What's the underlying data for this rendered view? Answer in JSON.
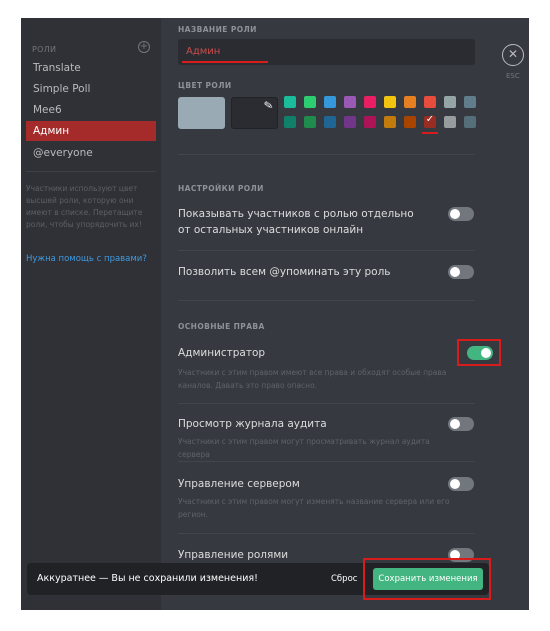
{
  "sidebar": {
    "header": "РОЛИ",
    "add_icon": "plus-circle-icon",
    "roles": [
      {
        "label": "Translate",
        "active": false
      },
      {
        "label": "Simple Poll",
        "active": false
      },
      {
        "label": "Mee6",
        "active": false
      },
      {
        "label": "Админ",
        "active": true
      },
      {
        "label": "@everyone",
        "active": false
      }
    ],
    "help_text": "Участники используют цвет высшей роли, которую они имеют в списке. Перетащите роли, чтобы упорядочить их!",
    "help_link": "Нужна помощь с правами?"
  },
  "role_name": {
    "label": "НАЗВАНИЕ РОЛИ",
    "value": "Админ"
  },
  "role_color": {
    "label": "ЦВЕТ РОЛИ",
    "picker_icon": "eyedropper-icon",
    "default_color": "#99aab5",
    "swatches_top": [
      "#1abc9c",
      "#2ecc71",
      "#3498db",
      "#9b59b6",
      "#e91e63",
      "#f1c40f",
      "#e67e22",
      "#e74c3c",
      "#95a5a6",
      "#607d8b"
    ],
    "swatches_bottom": [
      "#11806a",
      "#1f8b4c",
      "#206694",
      "#71368a",
      "#ad1457",
      "#c27c0e",
      "#a84300",
      "#992d22",
      "#979c9f",
      "#546e7a"
    ],
    "selected": "#992d22"
  },
  "role_settings": {
    "label": "НАСТРОЙКИ РОЛИ",
    "items": [
      {
        "title": "Показывать участников с ролью отдельно от остальных участников онлайн",
        "enabled": false
      },
      {
        "title": "Позволить всем @упоминать эту роль",
        "enabled": false
      }
    ]
  },
  "permissions": {
    "label": "ОСНОВНЫЕ ПРАВА",
    "items": [
      {
        "title": "Администратор",
        "desc": "Участники с этим правом имеют все права и обходят особые права каналов. Давать это право опасно.",
        "enabled": true
      },
      {
        "title": "Просмотр журнала аудита",
        "desc": "Участники с этим правом могут просматривать журнал аудита сервера",
        "enabled": false
      },
      {
        "title": "Управление сервером",
        "desc": "Участники с этим правом могут изменять название сервера или его регион.",
        "enabled": false
      },
      {
        "title": "Управление ролями",
        "desc": "",
        "enabled": false
      }
    ]
  },
  "close": {
    "icon": "close-icon",
    "label": "ESC"
  },
  "unsaved": {
    "message": "Аккуратнее — Вы не сохранили изменения!",
    "reset_label": "Сброс",
    "save_label": "Сохранить изменения"
  },
  "colors": {
    "accent_red": "#d81b1b",
    "toggle_on": "#43b581",
    "active_role": "#a52b2b"
  }
}
